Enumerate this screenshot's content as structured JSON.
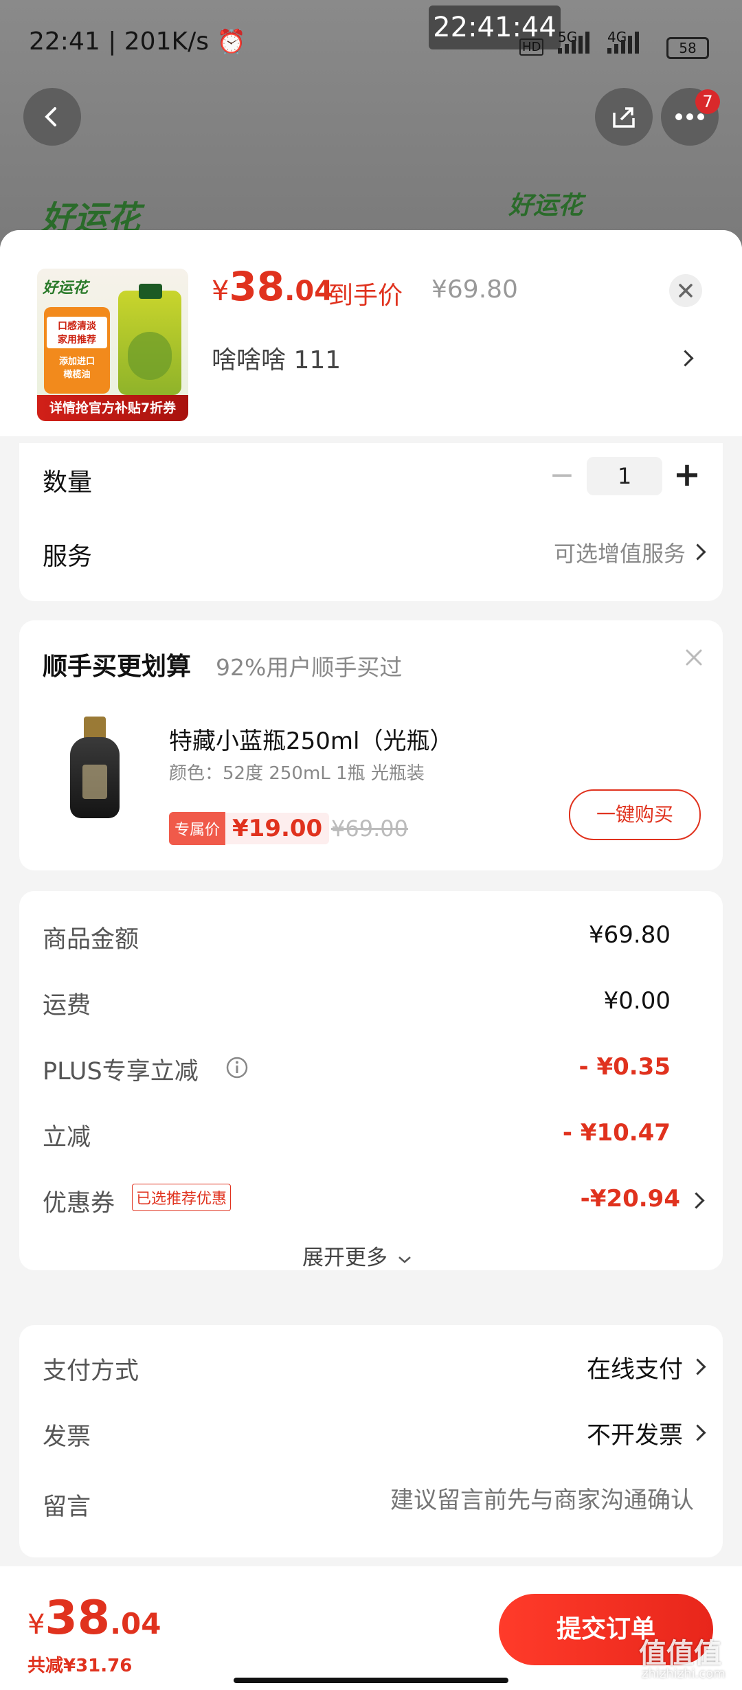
{
  "status_bar": {
    "time": "22:41",
    "speed": "201K/s",
    "floating_clock": "22:41:44",
    "hd": "HD",
    "net1": "5G",
    "net2": "4G",
    "battery": "58"
  },
  "nav": {
    "cart_badge": "7"
  },
  "product": {
    "image_caption": "详情抢官方补贴7折券",
    "image_brand": "好运花",
    "image_tag1": "口感清淡",
    "image_tag2": "家用推荐",
    "image_tag3": "添加进口",
    "image_tag4": "橄榄油",
    "price_symbol": "¥",
    "price_int": "38",
    "price_dec": ".04",
    "price_tag": "到手价",
    "orig_price": "¥69.80",
    "variant": "啥啥啥  111"
  },
  "qty": {
    "label": "数量",
    "value": "1",
    "minus": "−",
    "plus": "+"
  },
  "service": {
    "label": "服务",
    "value": "可选增值服务"
  },
  "upsell": {
    "title": "顺手买更划算",
    "subtitle": "92%用户顺手买过",
    "item_name": "特藏小蓝瓶250ml（光瓶）",
    "item_spec": "颜色：52度 250mL 1瓶 光瓶装",
    "exclusive_tag": "专属价",
    "exclusive_price": "¥19.00",
    "strike_price": "¥69.00",
    "buy_btn": "一键购买"
  },
  "summary": {
    "rows": [
      {
        "label": "商品金额",
        "value": "¥69.80"
      },
      {
        "label": "运费",
        "value": "¥0.00"
      },
      {
        "label": "PLUS专享立减",
        "value": "- ¥0.35"
      },
      {
        "label": "立减",
        "value": "- ¥10.47"
      },
      {
        "label": "优惠券",
        "value": "-¥20.94",
        "tag": "已选推荐优惠"
      }
    ],
    "expand": "展开更多"
  },
  "payment": {
    "method_label": "支付方式",
    "method_value": "在线支付",
    "invoice_label": "发票",
    "invoice_value": "不开发票",
    "note_label": "留言",
    "note_placeholder": "建议留言前先与商家沟通确认"
  },
  "footer": {
    "price_symbol": "¥",
    "price_int": "38",
    "price_dec": ".04",
    "saved": "共减¥31.76",
    "submit": "提交订单"
  },
  "watermark": "值值值",
  "watermark_sub": "zhizhizhi.com",
  "colors": {
    "accent": "#e0321e",
    "submit_start": "#ff3b2a",
    "submit_end": "#e8261b"
  }
}
